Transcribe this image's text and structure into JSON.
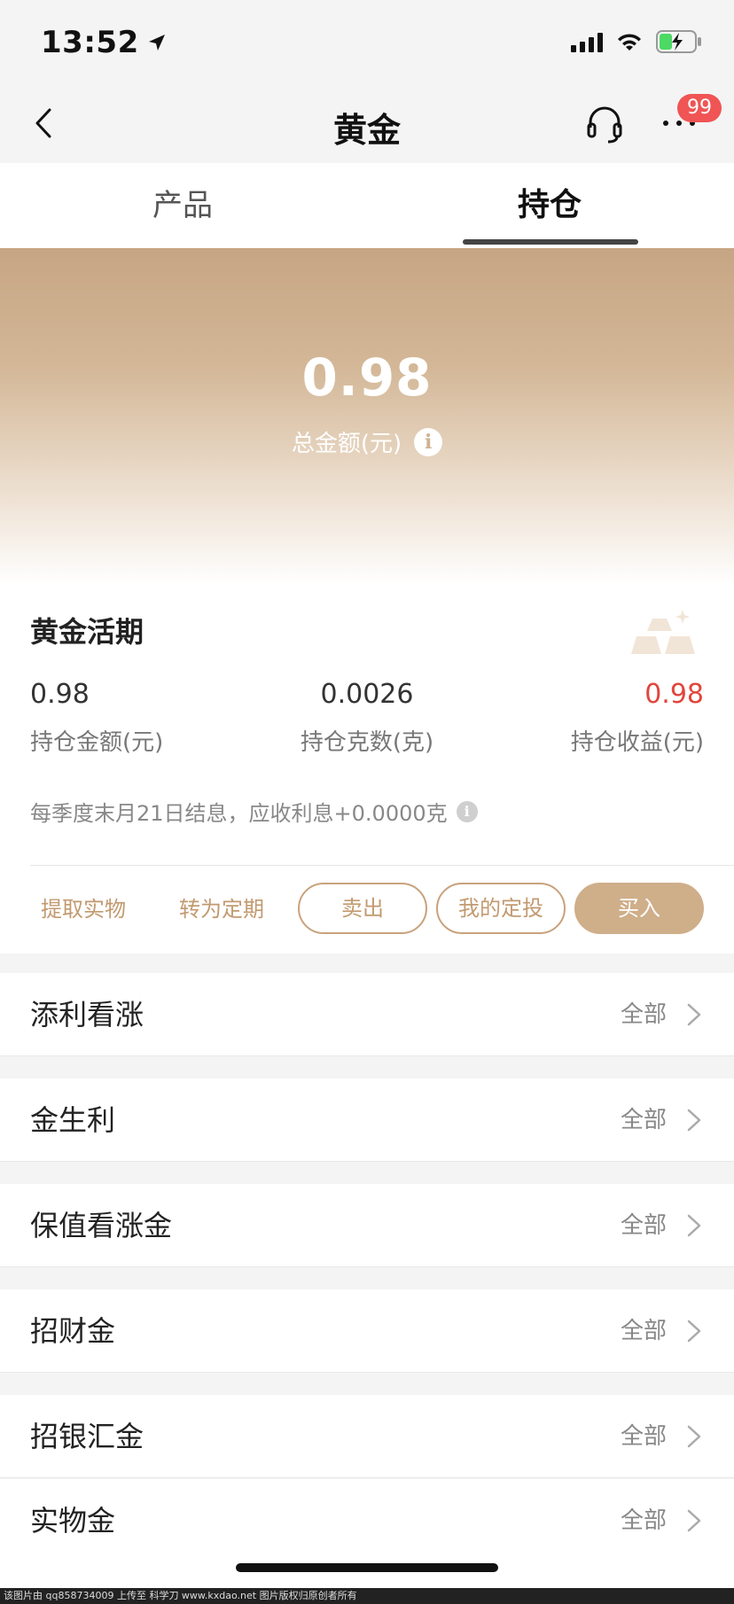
{
  "status_bar": {
    "time": "13:52"
  },
  "nav": {
    "title": "黄金",
    "badge_count": "99"
  },
  "tabs": [
    {
      "label": "产品"
    },
    {
      "label": "持仓"
    }
  ],
  "summary": {
    "total_amount": "0.98",
    "total_label": "总金额(元)",
    "info_glyph": "i"
  },
  "holding": {
    "title": "黄金活期",
    "stats": [
      {
        "value": "0.98",
        "label": "持仓金额(元)"
      },
      {
        "value": "0.0026",
        "label": "持仓克数(克)"
      },
      {
        "value": "0.98",
        "label": "持仓收益(元)"
      }
    ],
    "interest_note": "每季度末月21日结息，应收利息+0.0000克",
    "actions": [
      {
        "label": "提取实物"
      },
      {
        "label": "转为定期"
      },
      {
        "label": "卖出"
      },
      {
        "label": "我的定投"
      },
      {
        "label": "买入"
      }
    ]
  },
  "products": [
    {
      "title": "添利看涨",
      "more": "全部"
    },
    {
      "title": "金生利",
      "more": "全部"
    },
    {
      "title": "保值看涨金",
      "more": "全部"
    },
    {
      "title": "招财金",
      "more": "全部"
    },
    {
      "title": "招银汇金",
      "more": "全部"
    },
    {
      "title": "实物金",
      "more": "全部"
    }
  ],
  "footer_note": "该图片由 qq858734009 上传至 科学刀 www.kxdao.net 图片版权归原创者所有",
  "colors": {
    "accent": "#c29a70",
    "profit": "#e2453c",
    "badge": "#f05454"
  }
}
